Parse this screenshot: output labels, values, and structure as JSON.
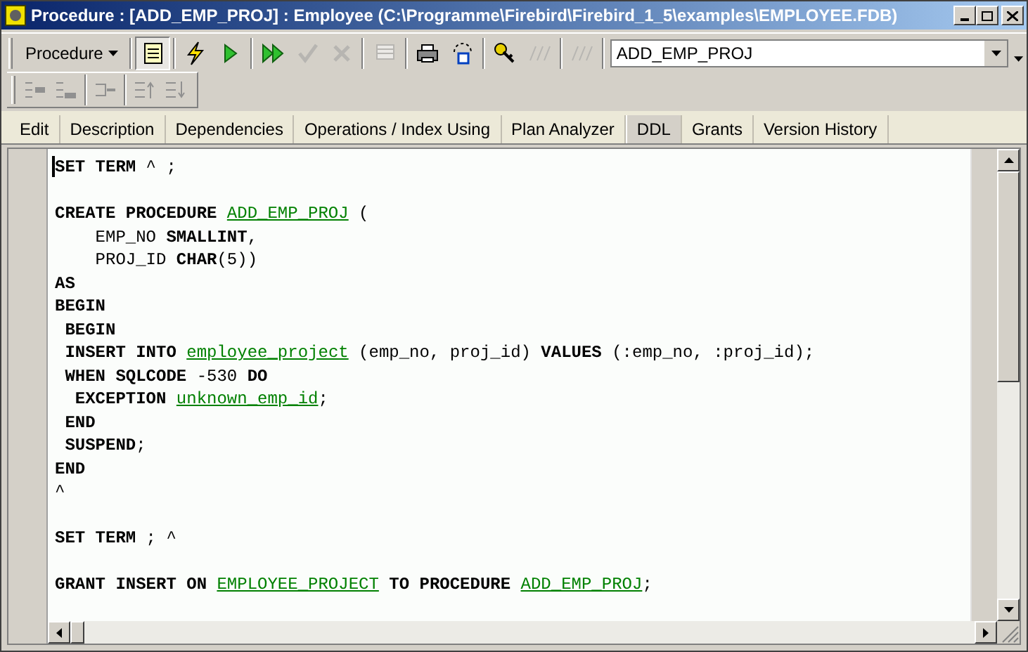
{
  "window": {
    "title": "Procedure : [ADD_EMP_PROJ] : Employee (C:\\Programme\\Firebird\\Firebird_1_5\\examples\\EMPLOYEE.FDB)"
  },
  "toolbar": {
    "menu_button": "Procedure",
    "buttons": [
      {
        "pressed": true,
        "disabled": false
      },
      {
        "pressed": false,
        "disabled": false
      },
      {
        "pressed": false,
        "disabled": false
      },
      {
        "pressed": false,
        "disabled": false
      },
      {
        "pressed": false,
        "disabled": true
      },
      {
        "pressed": false,
        "disabled": true
      },
      {
        "pressed": false,
        "disabled": true
      },
      {
        "pressed": false,
        "disabled": false
      },
      {
        "pressed": false,
        "disabled": false
      },
      {
        "pressed": false,
        "disabled": false
      },
      {
        "pressed": false,
        "disabled": true
      },
      {
        "pressed": false,
        "disabled": true
      }
    ],
    "object_select": {
      "value": "ADD_EMP_PROJ"
    }
  },
  "toolbar2": {
    "buttons": [
      {
        "disabled": true
      },
      {
        "disabled": true
      },
      {
        "disabled": true
      },
      {
        "disabled": true
      },
      {
        "disabled": true
      }
    ]
  },
  "tabs": [
    {
      "label": "Edit",
      "selected": false
    },
    {
      "label": "Description",
      "selected": false
    },
    {
      "label": "Dependencies",
      "selected": false
    },
    {
      "label": "Operations / Index Using",
      "selected": false
    },
    {
      "label": "Plan Analyzer",
      "selected": false
    },
    {
      "label": "DDL",
      "selected": true
    },
    {
      "label": "Grants",
      "selected": false
    },
    {
      "label": "Version History",
      "selected": false
    }
  ],
  "editor": {
    "lines": [
      [
        {
          "kind": "keyword",
          "text": "SET TERM"
        },
        {
          "kind": "plain",
          "text": " ^ ;"
        }
      ],
      {
        "space_before": true,
        "tokens": [
          {
            "kind": "keyword",
            "text": "CREATE PROCEDURE "
          },
          {
            "kind": "reference",
            "text": "ADD_EMP_PROJ"
          },
          {
            "kind": "plain",
            "text": " ("
          }
        ]
      },
      [
        {
          "kind": "plain",
          "text": "    EMP_NO "
        },
        {
          "kind": "keyword",
          "text": "SMALLINT"
        },
        {
          "kind": "plain",
          "text": ","
        }
      ],
      [
        {
          "kind": "plain",
          "text": "    PROJ_ID "
        },
        {
          "kind": "keyword",
          "text": "CHAR"
        },
        {
          "kind": "plain",
          "text": "(5))"
        }
      ],
      [
        {
          "kind": "keyword",
          "text": "AS"
        }
      ],
      [
        {
          "kind": "keyword",
          "text": "BEGIN"
        }
      ],
      [
        {
          "kind": "keyword",
          "text": " BEGIN"
        }
      ],
      [
        {
          "kind": "keyword",
          "text": " INSERT INTO "
        },
        {
          "kind": "reference",
          "text": "employee_project"
        },
        {
          "kind": "plain",
          "text": " (emp_no, proj_id) "
        },
        {
          "kind": "keyword",
          "text": "VALUES"
        },
        {
          "kind": "plain",
          "text": " (:emp_no, :proj_id);"
        }
      ],
      [
        {
          "kind": "keyword",
          "text": " WHEN SQLCODE "
        },
        {
          "kind": "plain",
          "text": "-530 "
        },
        {
          "kind": "keyword",
          "text": "DO"
        }
      ],
      [
        {
          "kind": "keyword",
          "text": "  EXCEPTION "
        },
        {
          "kind": "reference",
          "text": "unknown_emp_id"
        },
        {
          "kind": "plain",
          "text": ";"
        }
      ],
      [
        {
          "kind": "keyword",
          "text": " END"
        }
      ],
      [
        {
          "kind": "keyword",
          "text": " SUSPEND"
        },
        {
          "kind": "plain",
          "text": ";"
        }
      ],
      [
        {
          "kind": "keyword",
          "text": "END"
        }
      ],
      [
        {
          "kind": "plain",
          "text": "^"
        }
      ],
      {
        "space_before": true,
        "tokens": [
          {
            "kind": "keyword",
            "text": "SET TERM"
          },
          {
            "kind": "plain",
            "text": " ; ^"
          }
        ]
      },
      {
        "space_before": true,
        "tokens": [
          {
            "kind": "keyword",
            "text": "GRANT INSERT ON "
          },
          {
            "kind": "reference",
            "text": "EMPLOYEE_PROJECT"
          },
          {
            "kind": "keyword",
            "text": " TO PROCEDURE "
          },
          {
            "kind": "reference",
            "text": "ADD_EMP_PROJ"
          },
          {
            "kind": "plain",
            "text": ";"
          }
        ]
      }
    ]
  }
}
